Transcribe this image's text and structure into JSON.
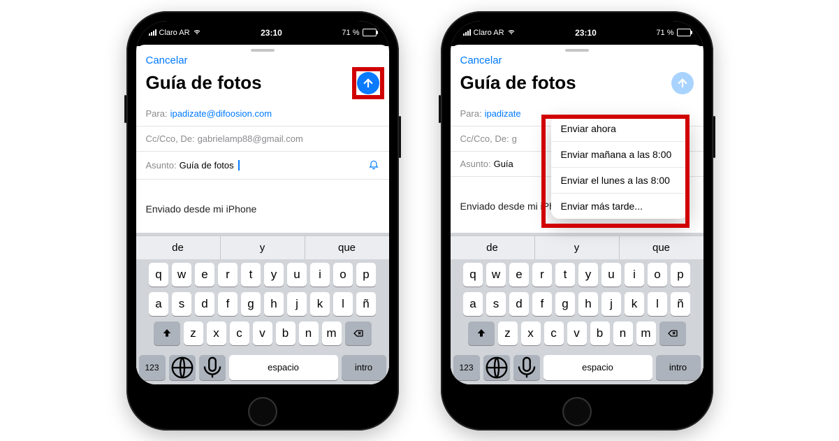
{
  "status": {
    "carrier": "Claro AR",
    "time": "23:10",
    "battery_text": "71 %"
  },
  "compose": {
    "cancel": "Cancelar",
    "title": "Guía de fotos",
    "to_label": "Para:",
    "to_value": "ipadizate@difoosion.com",
    "to_value_trunc": "ipadizate",
    "cc_label": "Cc/Cco, De:",
    "cc_value": "gabrielamp88@gmail.com",
    "cc_value_trunc": "g",
    "subject_label": "Asunto:",
    "subject_value": "Guía de fotos",
    "subject_value_trunc": "Guía",
    "signature": "Enviado desde mi iPhone"
  },
  "popup": {
    "items": [
      "Enviar ahora",
      "Enviar mañana a las 8:00",
      "Enviar el lunes a las 8:00",
      "Enviar más tarde..."
    ]
  },
  "keyboard": {
    "suggestions": [
      "de",
      "y",
      "que"
    ],
    "row1": [
      "q",
      "w",
      "e",
      "r",
      "t",
      "y",
      "u",
      "i",
      "o",
      "p"
    ],
    "row2": [
      "a",
      "s",
      "d",
      "f",
      "g",
      "h",
      "j",
      "k",
      "l",
      "ñ"
    ],
    "row3": [
      "z",
      "x",
      "c",
      "v",
      "b",
      "n",
      "m"
    ],
    "numbers": "123",
    "space": "espacio",
    "intro": "intro"
  }
}
